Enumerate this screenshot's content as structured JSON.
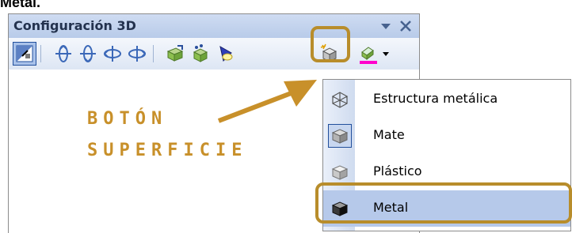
{
  "page_fragment": "Metal.",
  "panel": {
    "title": "Configuración 3D",
    "dropdown_glyph": "▾",
    "close_glyph": "✕",
    "toolbar": [
      {
        "icon": "3d-on-off-icon",
        "pressed": true
      },
      {
        "icon": "tilt-down-icon"
      },
      {
        "icon": "tilt-up-icon"
      },
      {
        "icon": "tilt-left-icon"
      },
      {
        "icon": "tilt-right-icon"
      },
      {
        "icon": "depth-icon"
      },
      {
        "icon": "direction-icon"
      },
      {
        "icon": "lighting-icon"
      },
      {
        "icon": "surface-icon",
        "highlighted": true
      },
      {
        "icon": "3d-color-icon",
        "has_dropdown": true
      }
    ]
  },
  "surface_menu": {
    "items": [
      {
        "label": "Estructura metálica",
        "icon": "wireframe-icon",
        "selected": false
      },
      {
        "label": "Mate",
        "icon": "matte-icon",
        "selected": false,
        "checked": true
      },
      {
        "label": "Plástico",
        "icon": "plastic-icon",
        "selected": false
      },
      {
        "label": "Metal",
        "icon": "metal-icon",
        "selected": true
      }
    ]
  },
  "annotation": {
    "line1": "BOTÓN",
    "line2": "SUPERFICIE"
  },
  "colors": {
    "highlight": "#b88d2b",
    "annotation": "#c8902a",
    "selection": "#b6c9ea",
    "color_bar": "#ff00cc"
  }
}
